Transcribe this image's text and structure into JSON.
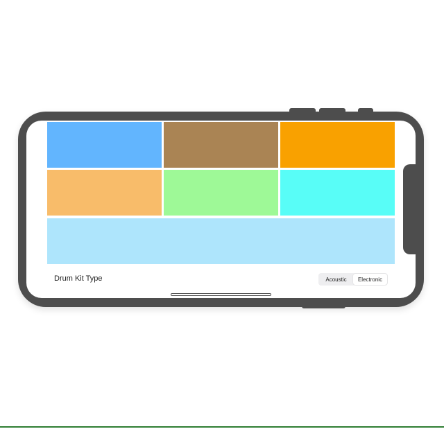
{
  "drum_pads": [
    {
      "color": "#62b5fe"
    },
    {
      "color": "#aa8454"
    },
    {
      "color": "#f9a100"
    },
    {
      "color": "#f8bc6a"
    },
    {
      "color": "#9ef997"
    },
    {
      "color": "#58fdf7"
    },
    {
      "color": "#aee5fc"
    }
  ],
  "controls": {
    "label": "Drum Kit Type",
    "options": [
      "Acoustic",
      "Electronic"
    ],
    "selected": "Electronic"
  },
  "colors": {
    "device_frame": "#4d4d4d",
    "screen_background": "#ffffff"
  }
}
